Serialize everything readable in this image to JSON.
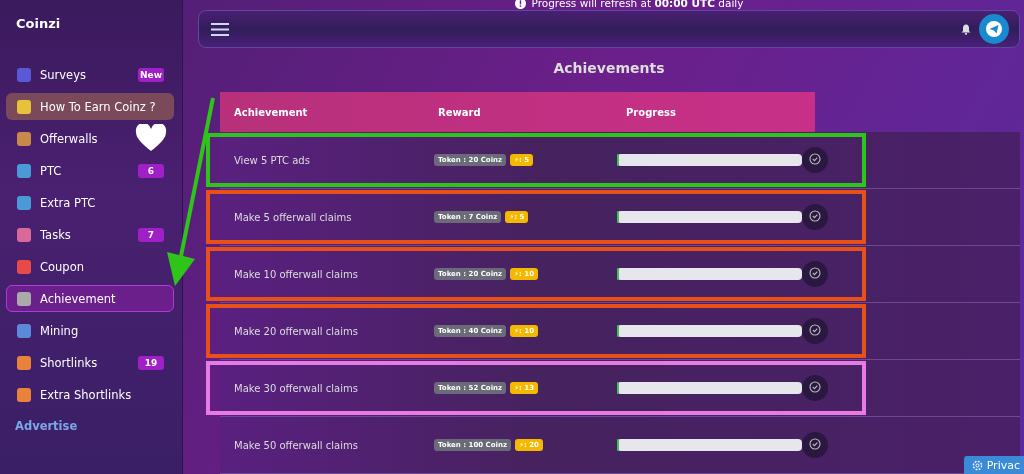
{
  "sidebar": {
    "brand": "Coinzi",
    "items": [
      {
        "label": "Surveys",
        "badge": "New",
        "kind": "normal",
        "selected": false
      },
      {
        "label": "How To Earn Coinz ?",
        "kind": "promo",
        "selected": false
      },
      {
        "label": "Offerwalls",
        "kind": "normal",
        "selected": false
      },
      {
        "label": "PTC",
        "badge": "6",
        "kind": "normal",
        "selected": false
      },
      {
        "label": "Extra PTC",
        "kind": "normal",
        "selected": false
      },
      {
        "label": "Tasks",
        "badge": "7",
        "kind": "normal",
        "selected": false
      },
      {
        "label": "Coupon",
        "kind": "normal",
        "selected": false
      },
      {
        "label": "Achievement",
        "kind": "normal",
        "selected": true
      },
      {
        "label": "Mining",
        "kind": "normal",
        "selected": false
      },
      {
        "label": "Shortlinks",
        "badge": "19",
        "kind": "normal",
        "selected": false
      },
      {
        "label": "Extra Shortlinks",
        "kind": "normal",
        "selected": false
      }
    ],
    "footer_link": "Advertise"
  },
  "notice": "Progress will refresh at **00:00 UTC** daily",
  "page_title": "Achievements",
  "table": {
    "columns": [
      "Achievement",
      "Reward",
      "Progress"
    ],
    "rows": [
      {
        "achievement": "View 5 PTC ads",
        "token": "Token : 20 Coinz",
        "energy": "⚡: 5",
        "level": 0,
        "color": "#2ec41a"
      },
      {
        "achievement": "Make 5 offerwall claims",
        "token": "Token : 7 Coinz",
        "energy": "⚡: 5",
        "level": 0,
        "color": "#e8501a"
      },
      {
        "achievement": "Make 10 offerwall claims",
        "token": "Token : 20 Coinz",
        "energy": "⚡: 10",
        "level": 0,
        "color": "#e8501a"
      },
      {
        "achievement": "Make 20 offerwall claims",
        "token": "Token : 40 Coinz",
        "energy": "⚡: 10",
        "level": 0,
        "color": "#e8501a"
      },
      {
        "achievement": "Make 30 offerwall claims",
        "token": "Token : 52 Coinz",
        "energy": "⚡: 13",
        "level": 0,
        "color": "#e77ae3"
      },
      {
        "achievement": "Make 50 offerwall claims",
        "token": "Token : 100 Coinz",
        "energy": "⚡: 20",
        "level": 0
      }
    ]
  },
  "privacy_button": "Privac"
}
